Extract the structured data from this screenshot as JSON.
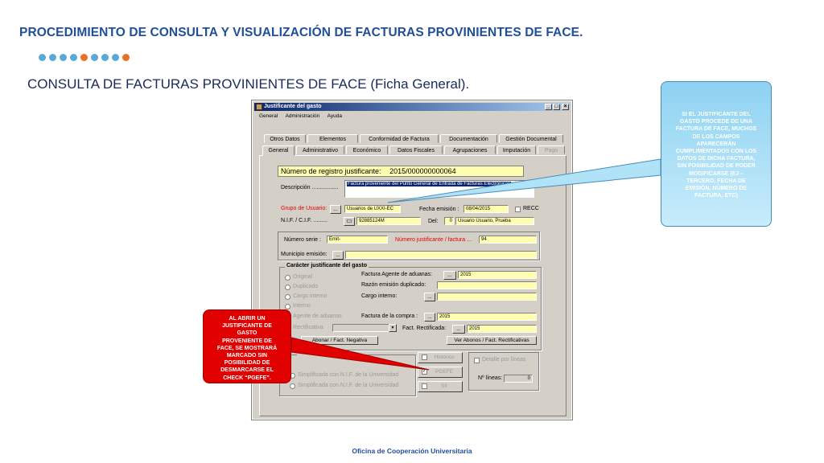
{
  "slide": {
    "title": "PROCEDIMIENTO DE CONSULTA Y VISUALIZACIÓN DE FACTURAS PROVINIENTES DE FACE.",
    "subtitle": "CONSULTA DE FACTURAS PROVINIENTES DE FACE (Ficha General).",
    "footer": "Oficina de Cooperación Universitaria",
    "dot_colors": [
      "#5aa8d8",
      "#5aa8d8",
      "#5aa8d8",
      "#5aa8d8",
      "#e8702a",
      "#5aa8d8",
      "#5aa8d8",
      "#5aa8d8",
      "#e8702a"
    ]
  },
  "window": {
    "title": "Justificante del gasto",
    "menu": [
      "General",
      "Administración",
      "Ayuda"
    ],
    "tabs_back": [
      "Otros Datos",
      "Elementos",
      "Conformidad de Factura",
      "Documentación",
      "Gestión Documental"
    ],
    "tabs_front": [
      "General",
      "Administrativo",
      "Económico",
      "Datos Fiscales",
      "Agrupaciones",
      "Imputación",
      "Pago"
    ]
  },
  "form": {
    "registro_label": "Número de registro justificante:",
    "registro_value": "2015/000000000064",
    "descripcion_label": "Descripción .................",
    "descripcion_value": "Factura proveniente del Punto General de Entrada de Facturas Electrónicas",
    "grupo_label": "Grupo de Usuario:",
    "grupo_value": "Usuarios de UXXI-EC",
    "fecha_label": "Fecha emisión :",
    "fecha_value": "08/04/2015",
    "recc_label": "RECC",
    "nif_label": "N.I.F. / C.I.F. .........",
    "nif_value": "92885124M",
    "del_label": "Del:",
    "del_value": "0",
    "del_name": "Usuario Usuario, Prueba",
    "numserie_label": "Número serie :",
    "numserie_value": "Emit-",
    "numjust_label": "Número justificante / factura ...",
    "numjust_value": "94",
    "municipio_label": "Municipio emisión:",
    "caracter_caption": "Carácter justificante del gasto",
    "radios": [
      "Original",
      "Duplicado",
      "Cargo interno",
      "Interno"
    ],
    "factura_agente_label": "Factura Agente de aduanas:",
    "factura_agente_value": "2015",
    "razon_label": "Razón emisión duplicado:",
    "cargo_label": "Cargo interno:",
    "agente_label": "Agente de aduanas",
    "factura_compra_label": "Factura de la compra :",
    "factura_compra_value": "2015",
    "rectificativa_label": "Rectificativa",
    "fact_rect_label": "Fact. Rectificada:",
    "fact_rect_value": "2015",
    "abonar_btn": "Abonar / Fact. Negativa",
    "ver_abonos_btn": "Ver Abonos / Fact. Rectificativas",
    "asociada_label": "Asociada a factura",
    "simplificada_1": "Simplificada con N.I.F. de la Universidad",
    "simplificada_2": "Simplificada con N.I.F. de la Universidad",
    "historico_label": "Histórico",
    "pgefe_label": "PGEFE",
    "sii_label": "SII",
    "detalle_label": "Detalle por líneas",
    "nlineas_label": "Nº líneas:",
    "nlineas_value": "0",
    "dots_btn": "...",
    "pgefe_check": "✓"
  },
  "callouts": {
    "blue_lines": [
      "SI EL JUSTIFICANTE DEL",
      "GASTO PROCEDE DE UNA",
      "FACTURA DE FACE, MUCHOS",
      "DE LOS CAMPOS",
      "APARECERÁN",
      "CUMPLIMENTADOS CON LOS",
      "DATOS DE DICHA FACTURA,",
      "SIN POSIBILIDAD DE PODER",
      "MODIFICARSE (EJ –",
      "TERCERO, FECHA DE",
      "EMISIÓN, NÚMERO DE",
      "FACTURA, ETC)"
    ],
    "red_lines": [
      "AL ABRIR UN",
      "JUSTIFICANTE DE",
      "GASTO",
      "PROVENIENTE DE",
      "FACE, SE MOSTRARÁ",
      "MARCADO SIN",
      "POSIBILIDAD DE",
      "DESMARCARSE EL",
      "CHECK “PGEFE”."
    ]
  }
}
